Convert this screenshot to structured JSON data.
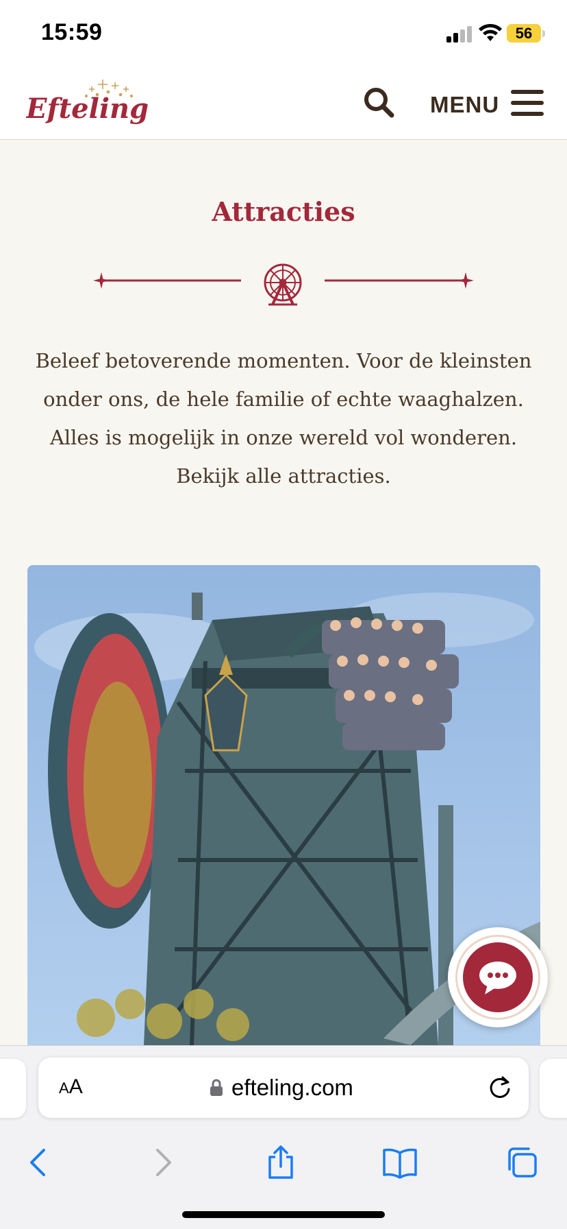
{
  "status_bar": {
    "time": "15:59",
    "battery": "56",
    "icons": [
      "signal-icon",
      "wifi-icon",
      "battery-icon"
    ]
  },
  "header": {
    "logo_text": "Efteling",
    "search_icon": "search-icon",
    "menu_label": "MENU",
    "menu_icon": "hamburger-icon"
  },
  "intro": {
    "title": "Attracties",
    "divider_icon": "ferris-wheel-icon",
    "text": "Beleef betoverende momenten. Voor de kleinsten onder ons, de hele familie of echte waaghalzen. Alles is mogelijk in onze wereld vol wonderen. Bekijk alle attracties."
  },
  "chat": {
    "icon": "chat-bubble-icon"
  },
  "browser": {
    "text_size_small": "A",
    "text_size_big": "A",
    "url": "efteling.com",
    "lock_icon": "lock-icon",
    "reload_icon": "reload-icon",
    "toolbar": [
      "back-icon",
      "forward-icon",
      "share-icon",
      "bookmarks-icon",
      "tabs-icon"
    ]
  },
  "colors": {
    "brand_red": "#a3283a",
    "text_brown": "#4a3a2a",
    "page_bg": "#f8f6f1",
    "ios_blue": "#1a7cf5"
  }
}
